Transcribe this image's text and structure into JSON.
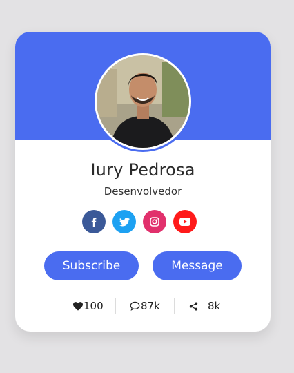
{
  "profile": {
    "name": "Iury Pedrosa",
    "role": "Desenvolvedor",
    "avatar_alt": "avatar"
  },
  "socials": [
    {
      "network": "facebook",
      "icon": "facebook-icon",
      "color": "#3b5998"
    },
    {
      "network": "twitter",
      "icon": "twitter-icon",
      "color": "#1da1f2"
    },
    {
      "network": "instagram",
      "icon": "instagram-icon",
      "color": "#e1306c"
    },
    {
      "network": "youtube",
      "icon": "youtube-icon",
      "color": "#ff0000"
    }
  ],
  "actions": {
    "subscribe_label": "Subscribe",
    "message_label": "Message"
  },
  "stats": {
    "likes": "100",
    "comments": "87k",
    "shares": "8k"
  },
  "colors": {
    "accent": "#4a6cf0",
    "background": "#e3e2e4",
    "card": "#ffffff"
  }
}
